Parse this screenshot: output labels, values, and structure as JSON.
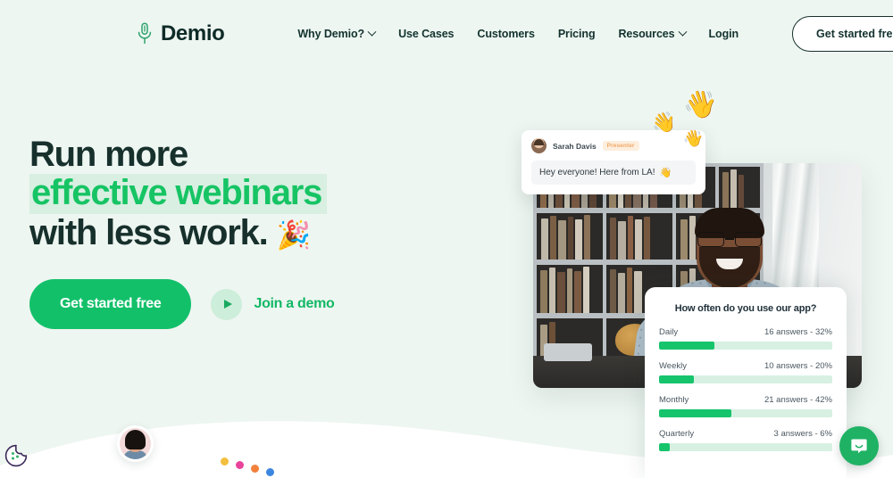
{
  "brand": {
    "name": "Demio",
    "logo_icon": "microphone-icon",
    "accent_green": "#13c06a",
    "dark": "#17302c",
    "page_bg": "#eef6f1",
    "highlight_bg": "#d8efe2"
  },
  "nav": {
    "items": [
      {
        "label": "Why Demio?",
        "has_caret": true
      },
      {
        "label": "Use Cases",
        "has_caret": false
      },
      {
        "label": "Customers",
        "has_caret": false
      },
      {
        "label": "Pricing",
        "has_caret": false
      },
      {
        "label": "Resources",
        "has_caret": true
      },
      {
        "label": "Login",
        "has_caret": false
      }
    ],
    "cta_label": "Get started free"
  },
  "hero": {
    "line1": "Run more",
    "line2_highlight": "effective webinars",
    "line3": "with less work.",
    "confetti_emoji": "🎉",
    "primary_cta": "Get started free",
    "demo_link": "Join a demo",
    "play_icon": "play-icon"
  },
  "chat": {
    "author": "Sarah Davis",
    "badge": "Presenter",
    "message": "Hey everyone! Here from LA!",
    "message_emoji": "👋",
    "floating_emojis": [
      "👋",
      "👋",
      "👋"
    ]
  },
  "poll": {
    "title": "How often do you use our app?",
    "rows": [
      {
        "option": "Daily",
        "meta": "16 answers - 32%",
        "percent": 32
      },
      {
        "option": "Weekly",
        "meta": "10 answers - 20%",
        "percent": 20
      },
      {
        "option": "Monthly",
        "meta": "21 answers - 42%",
        "percent": 42
      },
      {
        "option": "Quarterly",
        "meta": "3 answers - 6%",
        "percent": 6
      }
    ]
  },
  "decor": {
    "dots": [
      "#f3bf3f",
      "#e8439a",
      "#f2813c",
      "#3d86e0"
    ],
    "cookie_icon": "cookie-consent-icon",
    "chat_widget_icon": "chat-bubble-icon",
    "attendee_avatar": "attendee-avatar"
  }
}
